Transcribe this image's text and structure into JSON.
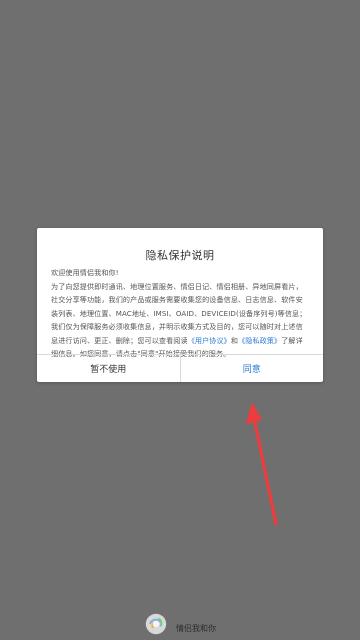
{
  "dialog": {
    "title": "隐私保护说明",
    "body_lines": [
      "欢迎使用情侣我和你!",
      "为了向您提供即时通讯、地理位置服务、情侣日记、情侣相册、异地同屏看片，",
      "社交分享等功能，我们的产品或服务需要收集您的设备信息、日志信息、软件安",
      "装列表、地理位置、MAC地址、IMSI、OAID、DEVICEID(设备序列号)等信息；",
      "我们仅为保障服务必须收集信息，并明示收集方式及目的，您可以随时对上述信",
      "息进行访问、更正、删除；您可以查看阅读",
      "《用户协议》",
      "和",
      "《隐私政策》",
      "了解详",
      "细信息。如您同意，请点击\"同意\"开始接受我们的服务。"
    ],
    "cancel_label": "暂不使用",
    "agree_label": "同意"
  },
  "footer": {
    "brand": "情侣我和你"
  },
  "colors": {
    "overlay": "#6f6f6f",
    "link": "#2b7bd6",
    "arrow": "#ef3b3b"
  },
  "icons": {
    "bottom_logo": "app-logo-icon",
    "annotation": "red-arrow-annotation"
  }
}
